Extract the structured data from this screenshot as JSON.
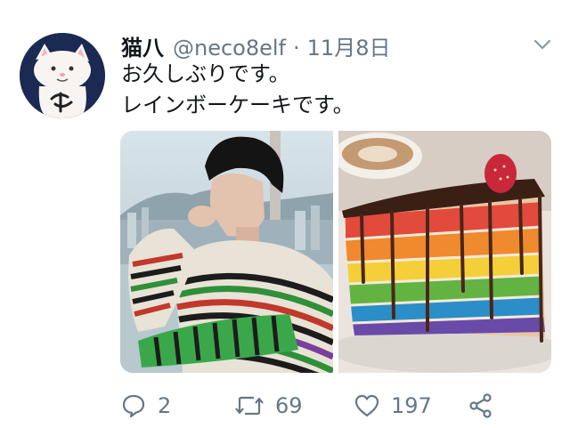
{
  "tweet": {
    "author": {
      "name": "猫八",
      "handle": "@neco8elf",
      "avatar": "cat-mascot-avatar"
    },
    "separator": "·",
    "date": "11月8日",
    "text_lines": [
      "お久しぶりです。",
      "レインボーケーキです。"
    ],
    "media": [
      {
        "type": "photo",
        "subject": "man-in-striped-sweater"
      },
      {
        "type": "photo",
        "subject": "rainbow-layer-cake"
      }
    ],
    "actions": {
      "reply_count": "2",
      "retweet_count": "69",
      "like_count": "197"
    },
    "icons": {
      "menu": "chevron-down-icon",
      "reply": "reply-icon",
      "retweet": "retweet-icon",
      "like": "heart-icon",
      "share": "share-icon"
    }
  },
  "colors": {
    "text": "#14171a",
    "secondary": "#657786",
    "avatar_bg": "#1a2a52"
  }
}
